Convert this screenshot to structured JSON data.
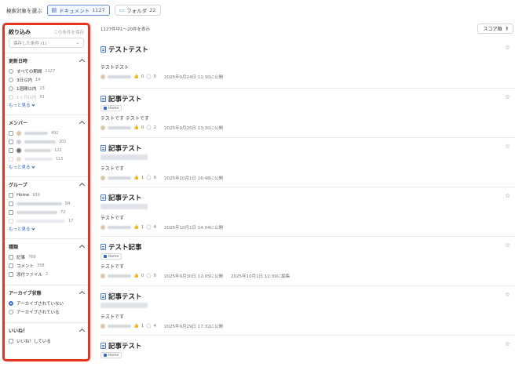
{
  "topbar": {
    "label": "検索対象を選ぶ",
    "documents": {
      "label": "ドキュメント",
      "count": "1127"
    },
    "folders": {
      "label": "フォルダ",
      "count": "22"
    }
  },
  "sidebar": {
    "title": "絞り込み",
    "save_link": "この条件を保存",
    "saved_select": "保存した条件 (1)",
    "sections": {
      "updated": {
        "title": "更新日時",
        "options": [
          {
            "label": "すべての期間",
            "count": "1127"
          },
          {
            "label": "3日以内",
            "count": "14"
          },
          {
            "label": "1週間以内",
            "count": "23"
          },
          {
            "label": "1ヶ月以内",
            "count": "51"
          }
        ],
        "more": "もっと見る"
      },
      "members": {
        "title": "メンバー",
        "counts": [
          "492",
          "201",
          "122",
          "115"
        ],
        "more": "もっと見る"
      },
      "groups": {
        "title": "グループ",
        "first_label": "Home",
        "counts": [
          "930",
          "84",
          "72",
          "17"
        ],
        "more": "もっと見る"
      },
      "types": {
        "title": "種類",
        "options": [
          {
            "label": "記事",
            "count": "769"
          },
          {
            "label": "コメント",
            "count": "358"
          },
          {
            "label": "添付ファイル",
            "count": "2"
          }
        ]
      },
      "archive": {
        "title": "アーカイブ状態",
        "options": [
          {
            "label": "アーカイブされていない"
          },
          {
            "label": "アーカイブされている"
          }
        ]
      },
      "likes": {
        "title": "いいね！",
        "options": [
          {
            "label": "いいね！している"
          }
        ]
      }
    }
  },
  "main": {
    "count_text": "1127件中1〜20件を表示",
    "sort_label": "スコア順",
    "items": [
      {
        "title": "テストテスト",
        "body": "テストテスト",
        "likes": "0",
        "comments": "0",
        "date": "2025年9月24日 11:30に公開",
        "tag": ""
      },
      {
        "title": "記事テスト",
        "tag": "Home",
        "body": "テストです テストです",
        "likes": "0",
        "comments": "2",
        "date": "2025年9月25日 13:30に公開"
      },
      {
        "title": "記事テスト",
        "tag": "",
        "body": "テストです",
        "likes": "1",
        "comments": "0",
        "date": "2025年10月1日 16:48に公開"
      },
      {
        "title": "記事テスト",
        "tag": "",
        "body": "テストです",
        "likes": "1",
        "comments": "4",
        "date": "2025年10月1日 14:04に公開"
      },
      {
        "title": "テスト記事",
        "tag": "Home",
        "body": "テストです",
        "likes": "0",
        "comments": "0",
        "date": "2025年9月30日 12:05に公開",
        "date2": "2025年10月1日 12:39に編集"
      },
      {
        "title": "記事テスト",
        "tag": "",
        "body": "テストです",
        "likes": "1",
        "comments": "4",
        "date": "2025年9月29日 17:32に公開"
      },
      {
        "title": "記事テスト",
        "tag": "Home",
        "body": "",
        "likes": "",
        "comments": "",
        "date": ""
      }
    ]
  },
  "colors": {
    "accent": "#3a6fd8",
    "highlight_border": "#e8331f"
  }
}
